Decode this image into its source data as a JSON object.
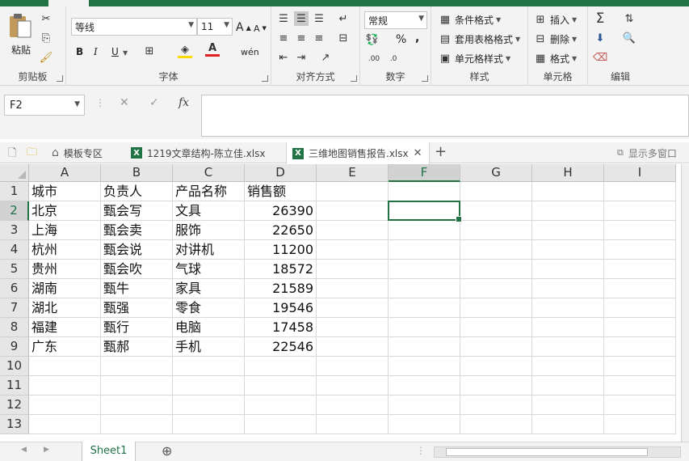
{
  "ribbon": {
    "clipboard": {
      "paste": "粘贴",
      "label": "剪贴板"
    },
    "font": {
      "name": "等线",
      "size": "11",
      "label": "字体",
      "bold": "B",
      "italic": "I",
      "underline": "U",
      "grow": "A",
      "shrink": "A",
      "phonetic": "wén"
    },
    "alignment": {
      "label": "对齐方式"
    },
    "number": {
      "format": "常规",
      "label": "数字",
      "percent": "%",
      "comma": ","
    },
    "styles": {
      "conditional": "条件格式",
      "table": "套用表格格式",
      "cell_styles": "单元格样式",
      "label": "样式"
    },
    "cells": {
      "insert": "插入",
      "delete": "删除",
      "format": "格式",
      "label": "单元格"
    },
    "editing": {
      "label": "编辑"
    }
  },
  "formula_bar": {
    "name_box": "F2",
    "cancel": "✕",
    "enter": "✓",
    "fx": "fx",
    "value": ""
  },
  "doc_tabs": {
    "template": "模板专区",
    "file1": "1219文章结构-陈立佳.xlsx",
    "file2": "三维地图销售报告.xlsx",
    "new_tab": "+",
    "multi_window": "显示多窗口"
  },
  "sheet": {
    "columns": [
      "A",
      "B",
      "C",
      "D",
      "E",
      "F",
      "G",
      "H",
      "I"
    ],
    "active_column": "F",
    "active_row": "2",
    "rows": [
      {
        "num": "1",
        "cells": [
          "城市",
          "负责人",
          "产品名称",
          "销售额"
        ]
      },
      {
        "num": "2",
        "cells": [
          "北京",
          "甄会写",
          "文具",
          "26390"
        ]
      },
      {
        "num": "3",
        "cells": [
          "上海",
          "甄会卖",
          "服饰",
          "22650"
        ]
      },
      {
        "num": "4",
        "cells": [
          "杭州",
          "甄会说",
          "对讲机",
          "11200"
        ]
      },
      {
        "num": "5",
        "cells": [
          "贵州",
          "甄会吹",
          "气球",
          "18572"
        ]
      },
      {
        "num": "6",
        "cells": [
          "湖南",
          "甄牛",
          "家具",
          "21589"
        ]
      },
      {
        "num": "7",
        "cells": [
          "湖北",
          "甄强",
          "零食",
          "19546"
        ]
      },
      {
        "num": "8",
        "cells": [
          "福建",
          "甄行",
          "电脑",
          "17458"
        ]
      },
      {
        "num": "9",
        "cells": [
          "广东",
          "甄郝",
          "手机",
          "22546"
        ]
      },
      {
        "num": "10",
        "cells": [
          "",
          "",
          "",
          ""
        ]
      },
      {
        "num": "11",
        "cells": [
          "",
          "",
          "",
          ""
        ]
      },
      {
        "num": "12",
        "cells": [
          "",
          "",
          "",
          ""
        ]
      },
      {
        "num": "13",
        "cells": [
          "",
          "",
          "",
          ""
        ]
      }
    ]
  },
  "sheet_tabs": {
    "active": "Sheet1",
    "add": "⊕"
  }
}
